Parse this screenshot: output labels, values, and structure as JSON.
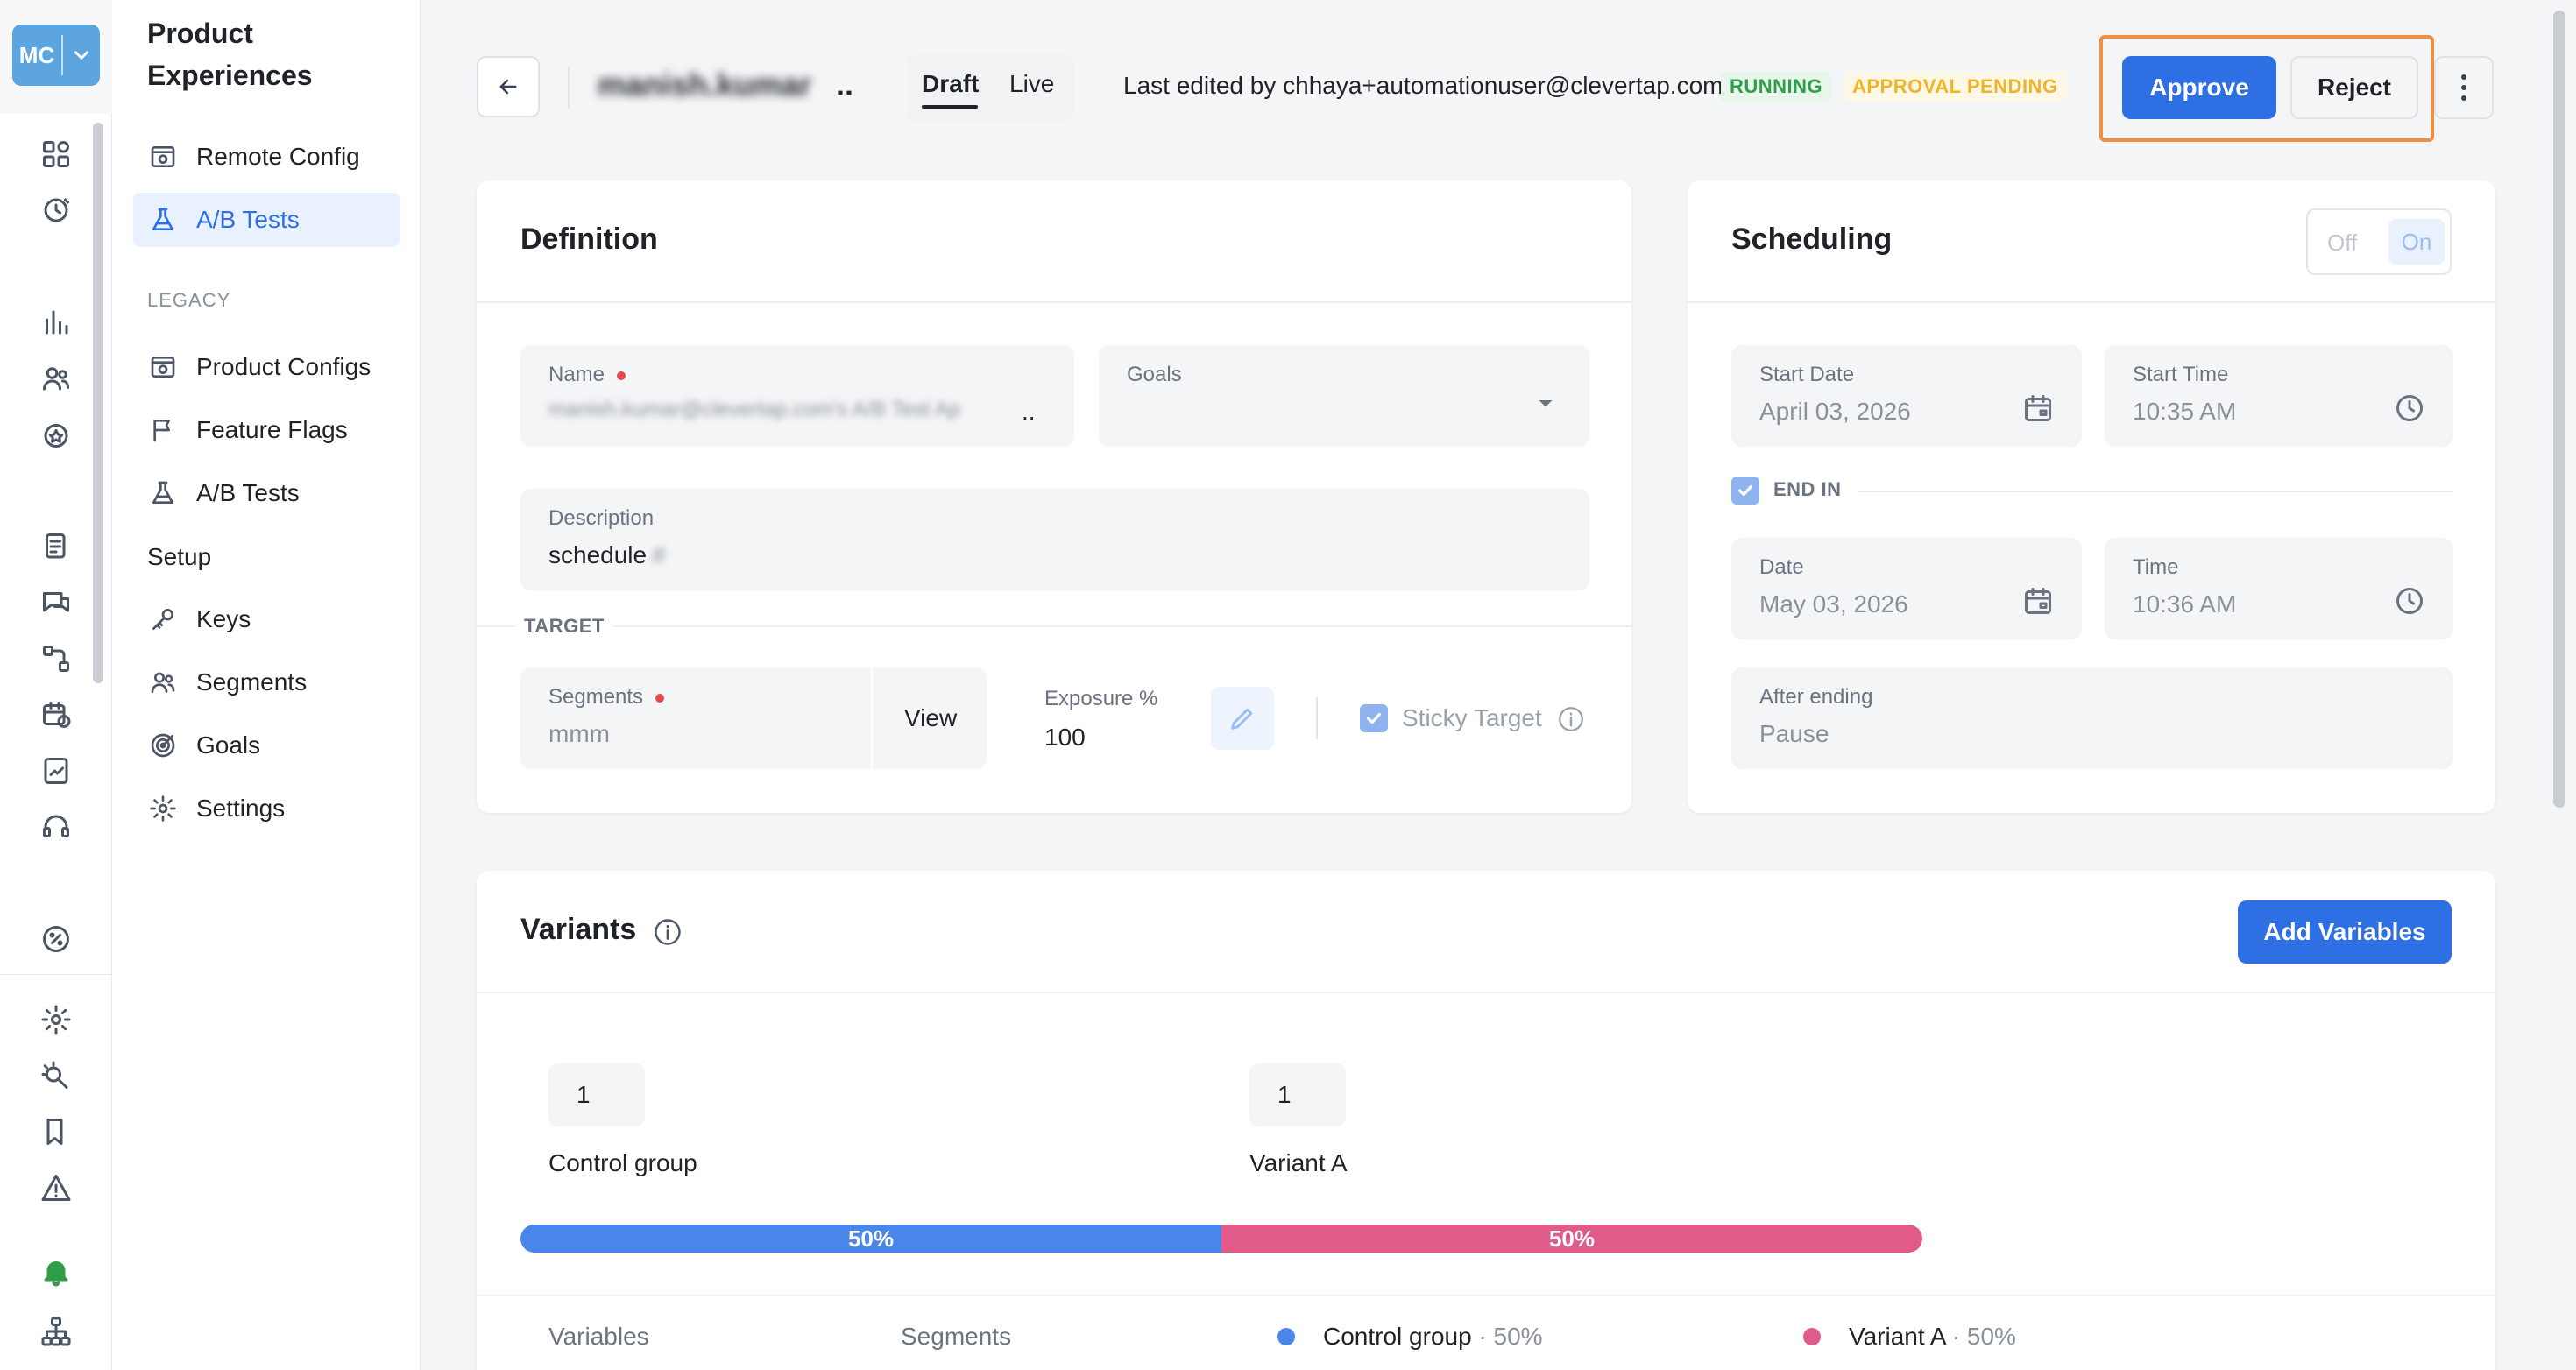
{
  "account": {
    "initials": "MC"
  },
  "sidebar": {
    "title": "Product Experiences",
    "items": [
      {
        "label": "Remote Config",
        "icon": "remote-config-icon"
      },
      {
        "label": "A/B Tests",
        "icon": "flask-icon",
        "active": true
      }
    ],
    "legacy_label": "LEGACY",
    "legacy_items": [
      {
        "label": "Product Configs",
        "icon": "product-config-icon"
      },
      {
        "label": "Feature Flags",
        "icon": "flag-icon"
      },
      {
        "label": "A/B Tests",
        "icon": "flask-icon"
      }
    ],
    "setup_label": "Setup",
    "setup_items": [
      {
        "label": "Keys",
        "icon": "key-icon"
      },
      {
        "label": "Segments",
        "icon": "users-icon"
      },
      {
        "label": "Goals",
        "icon": "target-icon"
      },
      {
        "label": "Settings",
        "icon": "gear-icon"
      }
    ]
  },
  "header": {
    "experience_name": "manish.kumar",
    "name_ellipsis": "..",
    "tabs": [
      "Draft",
      "Live"
    ],
    "active_tab": "Draft",
    "last_edited": "Last edited by chhaya+automationuser@clevertap.com",
    "status": "RUNNING",
    "approval_status": "APPROVAL PENDING",
    "approve_label": "Approve",
    "reject_label": "Reject",
    "accent": "#2f6fe4"
  },
  "definition": {
    "title": "Definition",
    "name_label": "Name",
    "name_value": "manish.kumar@clevertap.com's A/B Test Ap",
    "name_ellipsis": "..",
    "goals_label": "Goals",
    "goals_value": "",
    "description_label": "Description",
    "description_value": "schedule",
    "description_tail": "#",
    "target_label": "TARGET",
    "segments_label": "Segments",
    "segments_value": "mmm",
    "view_label": "View",
    "exposure_label": "Exposure %",
    "exposure_value": "100",
    "sticky_label": "Sticky Target",
    "sticky_checked": true
  },
  "scheduling": {
    "title": "Scheduling",
    "toggle_off": "Off",
    "toggle_on": "On",
    "start_date_label": "Start Date",
    "start_date_value": "April 03, 2026",
    "start_time_label": "Start Time",
    "start_time_value": "10:35 AM",
    "end_in_label": "END IN",
    "end_in_checked": true,
    "date_label": "Date",
    "date_value": "May 03, 2026",
    "time_label": "Time",
    "time_value": "10:36 AM",
    "after_ending_label": "After ending",
    "after_ending_value": "Pause"
  },
  "variants": {
    "title": "Variants",
    "add_variables_label": "Add Variables",
    "groups": [
      {
        "name": "Control group",
        "weight": "1",
        "percent": 50,
        "percent_label": "50%",
        "color": "#4a86ea"
      },
      {
        "name": "Variant A",
        "weight": "1",
        "percent": 50,
        "percent_label": "50%",
        "color": "#e05a8a"
      }
    ],
    "columns": [
      "Variables",
      "Segments"
    ],
    "legend": [
      {
        "name": "Control group",
        "suffix": "· 50%",
        "color": "#4a86ea"
      },
      {
        "name": "Variant A",
        "suffix": "· 50%",
        "color": "#e05a8a"
      }
    ]
  }
}
